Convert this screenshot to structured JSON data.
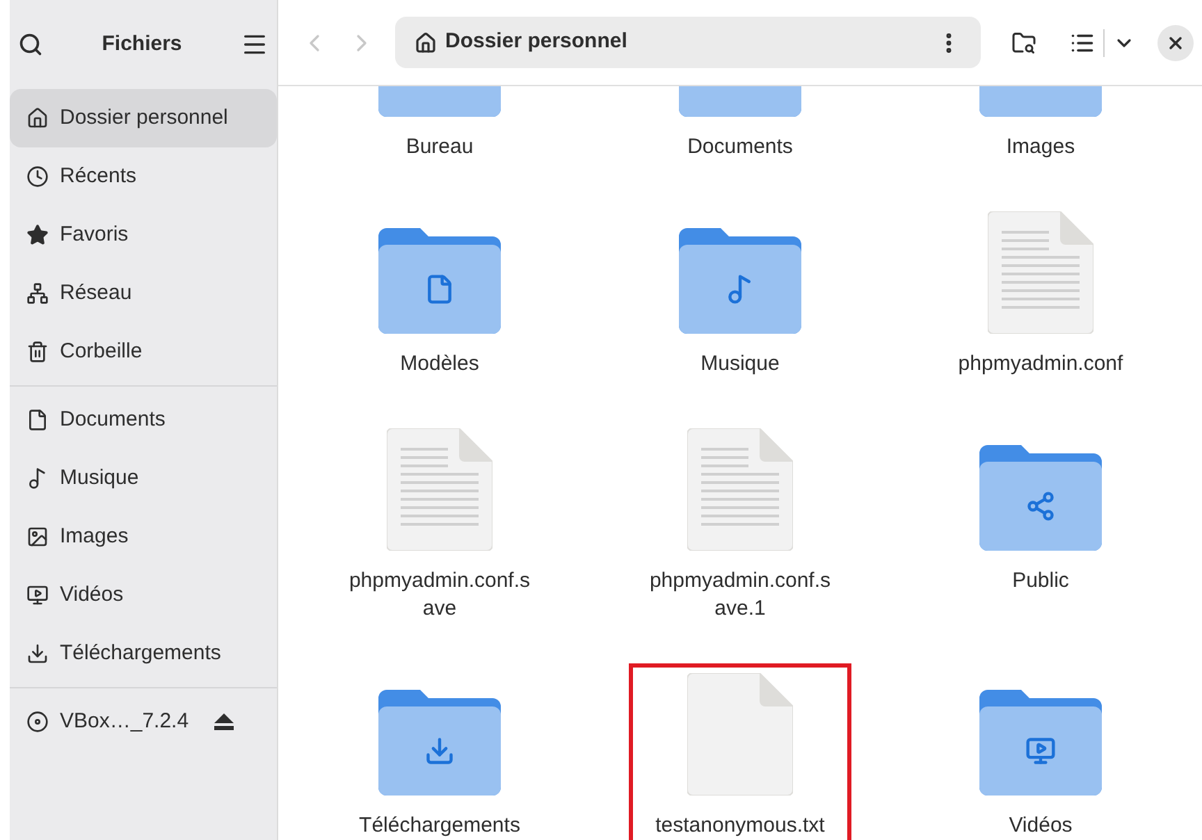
{
  "sidebar": {
    "title": "Fichiers",
    "groups": [
      [
        {
          "label": "Dossier personnel",
          "kind": "place",
          "selected": true
        },
        {
          "label": "Récents",
          "kind": "place",
          "selected": false
        },
        {
          "label": "Favoris",
          "kind": "place",
          "selected": false
        },
        {
          "label": "Réseau",
          "kind": "place",
          "selected": false
        },
        {
          "label": "Corbeille",
          "kind": "place",
          "selected": false
        }
      ],
      [
        {
          "label": "Documents",
          "kind": "place",
          "selected": false
        },
        {
          "label": "Musique",
          "kind": "place",
          "selected": false
        },
        {
          "label": "Images",
          "kind": "place",
          "selected": false
        },
        {
          "label": "Vidéos",
          "kind": "place",
          "selected": false
        },
        {
          "label": "Téléchargements",
          "kind": "place",
          "selected": false
        }
      ],
      [
        {
          "label": "VBox…_7.2.4",
          "kind": "drive",
          "selected": false
        }
      ]
    ]
  },
  "toolbar": {
    "back_disabled": true,
    "forward_disabled": true,
    "path": "Dossier personnel"
  },
  "files": [
    {
      "name": "Bureau",
      "kind": "folder",
      "highlighted": false
    },
    {
      "name": "Documents",
      "kind": "folder",
      "highlighted": false
    },
    {
      "name": "Images",
      "kind": "folder",
      "highlighted": false
    },
    {
      "name": "Modèles",
      "kind": "templates",
      "highlighted": false
    },
    {
      "name": "Musique",
      "kind": "music",
      "highlighted": false
    },
    {
      "name": "phpmyadmin.conf",
      "kind": "document",
      "highlighted": false
    },
    {
      "name": "phpmyadmin.conf.s ave",
      "kind": "document",
      "highlighted": false
    },
    {
      "name": "phpmyadmin.conf.s ave.1",
      "kind": "document",
      "highlighted": false
    },
    {
      "name": "Public",
      "kind": "public",
      "highlighted": false
    },
    {
      "name": "Téléchargements",
      "kind": "downloads",
      "highlighted": false
    },
    {
      "name": "testanonymous.txt",
      "kind": "blank",
      "highlighted": true
    },
    {
      "name": "Vidéos",
      "kind": "videos",
      "highlighted": false
    }
  ]
}
